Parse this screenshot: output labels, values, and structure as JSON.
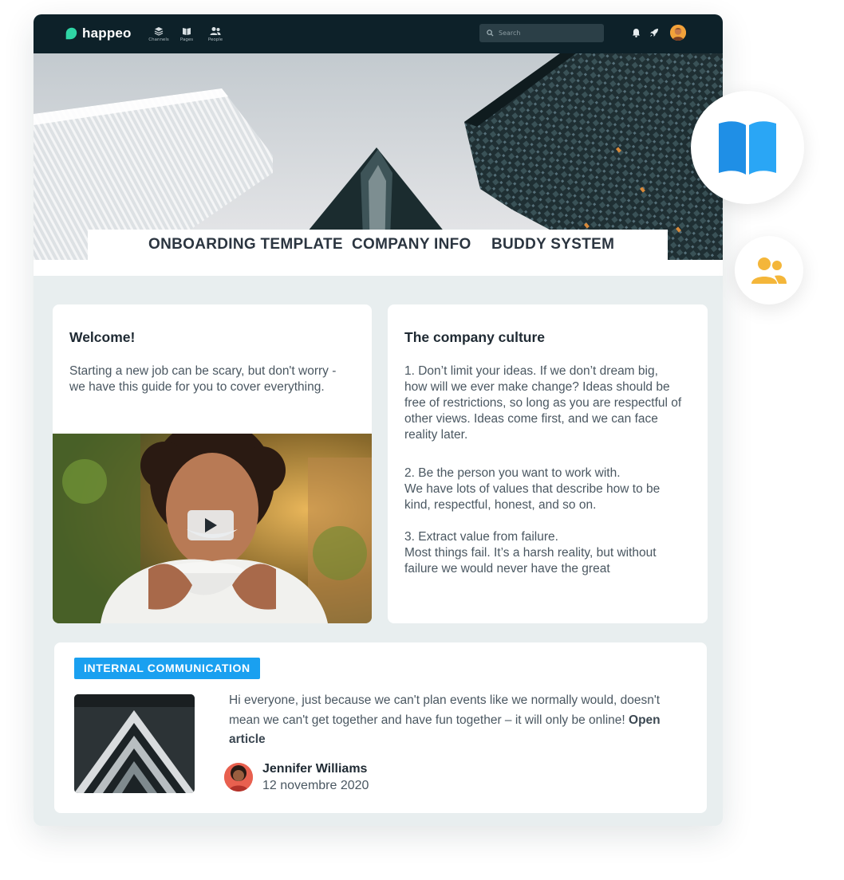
{
  "app": {
    "name": "happeo"
  },
  "nav": [
    {
      "label": "Channels",
      "icon": "layers-icon"
    },
    {
      "label": "Pages",
      "icon": "book-icon"
    },
    {
      "label": "People",
      "icon": "people-icon"
    }
  ],
  "search": {
    "placeholder": "Search"
  },
  "topbar_icons": [
    "bell-icon",
    "rocket-icon",
    "user-avatar"
  ],
  "tabs": [
    {
      "label": "ONBOARDING TEMPLATE"
    },
    {
      "label": "COMPANY INFO"
    },
    {
      "label": "BUDDY SYSTEM"
    }
  ],
  "welcome": {
    "title": "Welcome!",
    "text_lines": [
      "Starting a new job can be scary, but don't worry -",
      "we have this guide for you to cover everything."
    ],
    "video_icon": "play-icon"
  },
  "culture": {
    "title": "The company culture",
    "p1": [
      "1. Don’t limit your ideas. If we don’t dream big,",
      "how will we ever make change? Ideas should be",
      "free of restrictions, so long as you are respectful of",
      "other views. Ideas come first, and we can face",
      "reality later."
    ],
    "p2": [
      "2. Be the person you want to work with.",
      "We have lots of values that describe how to be",
      "kind, respectful, honest, and so on."
    ],
    "p3": [
      "3. Extract value from failure.",
      "Most things fail. It’s a harsh reality, but without",
      "failure we would never have the great"
    ]
  },
  "post": {
    "tag": "INTERNAL COMMUNICATION",
    "text_lines": [
      "Hi everyone, just because we can't plan events like we normally would, doesn't",
      "mean we can't get together and have fun together – it will only be online!"
    ],
    "link_first": "Open",
    "link_second": "article",
    "author": "Jennifer Williams",
    "date": "12 novembre 2020"
  },
  "floating_badges": [
    "open-book-icon",
    "people-group-icon"
  ],
  "colors": {
    "topbar": "#0d2129",
    "accent_tag": "#1aa0f0",
    "logo_green": "#2fd5a5",
    "badge_blue": "#2aa6f5",
    "badge_yellow": "#f4b63a",
    "page_bg": "#e8eeef"
  }
}
